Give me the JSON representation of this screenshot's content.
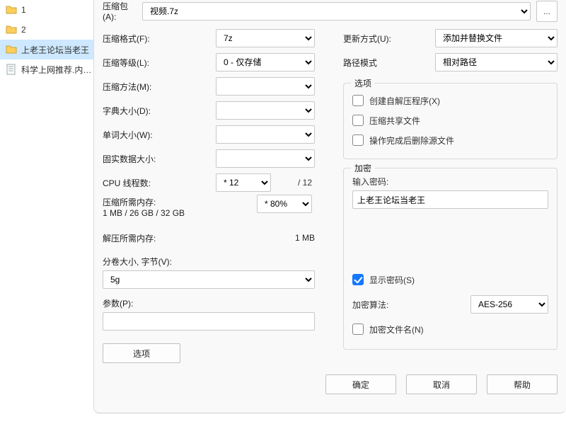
{
  "sidebar": {
    "items": [
      {
        "label": "1"
      },
      {
        "label": "2"
      },
      {
        "label": "上老王论坛当老王"
      },
      {
        "label": "科学上网推荐.内…"
      }
    ]
  },
  "archive": {
    "label": "压缩包(A):",
    "value": "视频.7z"
  },
  "left": {
    "format_label": "压缩格式(F):",
    "format_value": "7z",
    "level_label": "压缩等级(L):",
    "level_value": "0 - 仅存储",
    "method_label": "压缩方法(M):",
    "method_value": "",
    "dict_label": "字典大小(D):",
    "dict_value": "",
    "word_label": "单词大小(W):",
    "word_value": "",
    "solid_label": "固实数据大小:",
    "solid_value": "",
    "threads_label": "CPU 线程数:",
    "threads_value": "* 12",
    "threads_total": "/ 12",
    "compress_mem_label": "压缩所需内存:",
    "compress_mem_value": "1 MB / 26 GB / 32 GB",
    "percent_value": "* 80%",
    "decompress_mem_label": "解压所需内存:",
    "decompress_mem_value": "1 MB",
    "volume_label": "分卷大小, 字节(V):",
    "volume_value": "5g",
    "params_label": "参数(P):",
    "params_value": "",
    "options_btn": "选项"
  },
  "right": {
    "update_label": "更新方式(U):",
    "update_value": "添加并替换文件",
    "path_label": "路径模式",
    "path_value": "相对路径",
    "options_group": "选项",
    "sfx_label": "创建自解压程序(X)",
    "shared_label": "压缩共享文件",
    "delete_after_label": "操作完成后删除源文件",
    "encrypt_group": "加密",
    "password_label": "输入密码:",
    "password_value": "上老王论坛当老王",
    "show_password_label": "显示密码(S)",
    "algo_label": "加密算法:",
    "algo_value": "AES-256",
    "encrypt_names_label": "加密文件名(N)"
  },
  "buttons": {
    "ok": "确定",
    "cancel": "取消",
    "help": "帮助"
  },
  "browse_label": "..."
}
